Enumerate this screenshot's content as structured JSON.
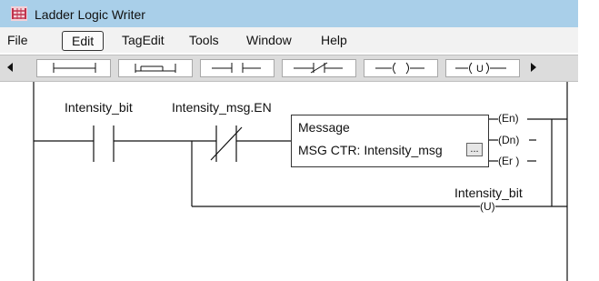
{
  "window": {
    "title": "Ladder Logic Writer"
  },
  "menu": {
    "items": [
      "File",
      "Edit",
      "TagEdit",
      "Tools",
      "Window",
      "Help"
    ],
    "selected": "Edit"
  },
  "toolbar": {
    "instructions": [
      "branch-start",
      "branch-end",
      "xic",
      "xio",
      "ote",
      "otu"
    ]
  },
  "rung": {
    "contact1_tag": "Intensity_bit",
    "contact2_tag": "Intensity_msg.EN",
    "msg_title": "Message",
    "msg_line": "MSG CTR: Intensity_msg",
    "msg_button": "...",
    "coil_en": "(En)",
    "coil_dn": "(Dn)",
    "coil_er": "(Er )",
    "unlatch_tag": "Intensity_bit",
    "unlatch_coil": "(U)"
  },
  "colors": {
    "titlebar": "#a9cfe9",
    "menubar": "#f2f2f2",
    "toolbar": "#dcdcdc"
  }
}
